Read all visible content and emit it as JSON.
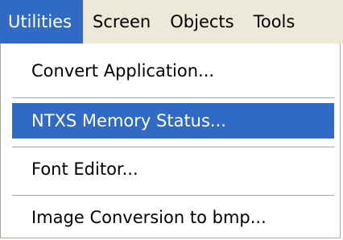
{
  "menubar": {
    "items": [
      {
        "label": "Utilities"
      },
      {
        "label": "Screen"
      },
      {
        "label": "Objects"
      },
      {
        "label": "Tools"
      }
    ]
  },
  "dropdown": {
    "items": [
      {
        "label": "Convert Application..."
      },
      {
        "label": "NTXS Memory Status..."
      },
      {
        "label": "Font Editor..."
      },
      {
        "label": "Image Conversion to bmp..."
      }
    ]
  },
  "colors": {
    "highlight": "#316ac5",
    "menubar_bg": "#ece9d8",
    "separator": "#aca899"
  }
}
